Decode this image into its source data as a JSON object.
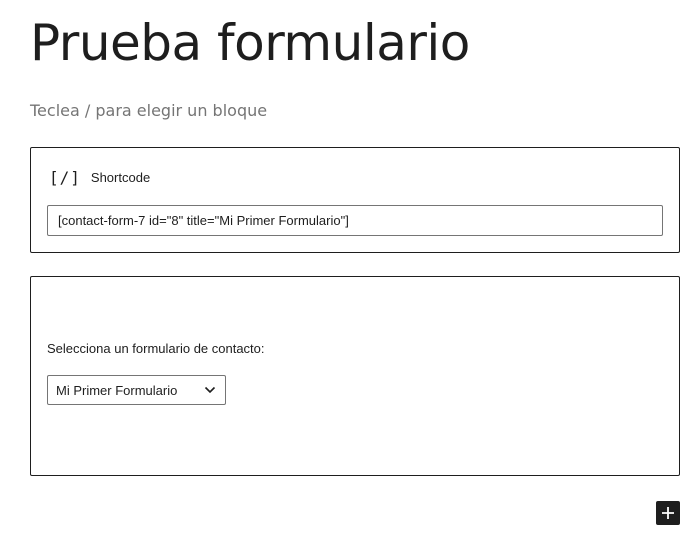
{
  "post": {
    "title": "Prueba formulario",
    "block_placeholder": "Teclea / para elegir un bloque"
  },
  "shortcode_block": {
    "icon": "[/]",
    "label": "Shortcode",
    "value": "[contact-form-7 id=\"8\" title=\"Mi Primer Formulario\"]"
  },
  "cf7_block": {
    "label": "Selecciona un formulario de contacto:",
    "selected_form": "Mi Primer Formulario"
  },
  "icons": {
    "shortcode": "shortcode-icon",
    "select": "chevron-down-icon",
    "inserter": "plus-icon"
  }
}
